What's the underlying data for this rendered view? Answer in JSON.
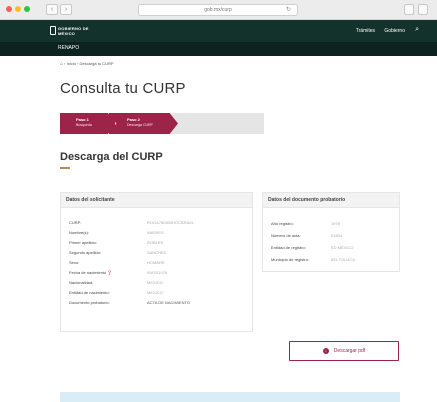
{
  "browser": {
    "url": "gob.mx/curp",
    "back": "‹",
    "forward": "›",
    "reload": "↻"
  },
  "header": {
    "logo_line1": "GOBIERNO DE",
    "logo_line2": "MÉXICO",
    "links": [
      "Trámites",
      "Gobierno"
    ],
    "search_icon": "search-icon"
  },
  "subheader": {
    "title": "RENAPO"
  },
  "breadcrumb": {
    "home_icon": "home-icon",
    "text": "› Inicio › Descarga tu CURP"
  },
  "page_title": "Consulta tu CURP",
  "stepper": {
    "steps": [
      {
        "title": "Paso 1",
        "subtitle": "Búsqueda"
      },
      {
        "title": "Paso 2",
        "subtitle": "Descarga CURP"
      }
    ]
  },
  "section_title": "Descarga del CURP",
  "solicitante": {
    "heading": "Datos del solicitante",
    "rows": [
      {
        "label": "CURP:",
        "value": "ROGA780309HOCBRA01"
      },
      {
        "label": "Nombre(s):",
        "value": "ANDRES"
      },
      {
        "label": "Primer apellido:",
        "value": "ROBLES"
      },
      {
        "label": "Segundo apellido:",
        "value": "SANCHEZ"
      },
      {
        "label": "Sexo:",
        "value": "HOMBRE"
      },
      {
        "label": "Fecha de nacimiento",
        "value": "09/03/1978"
      },
      {
        "label": "Nacionalidad:",
        "value": "MEXICO"
      },
      {
        "label": "Entidad de nacimiento:",
        "value": "MEXICO"
      },
      {
        "label": "Documento probatorio:",
        "value": "ACTA DE NACIMIENTO"
      }
    ]
  },
  "probatorio": {
    "heading": "Datos del documento probatorio",
    "rows": [
      {
        "label": "Año registro:",
        "value": "1978"
      },
      {
        "label": "Número de acta:",
        "value": "01804"
      },
      {
        "label": "Entidad de registro:",
        "value": "ED MÉXICO"
      },
      {
        "label": "Municipio de registro:",
        "value": "051 TOLUCA"
      }
    ]
  },
  "download": {
    "label": "Descargar pdf",
    "icon": "download-icon"
  },
  "colors": {
    "header_bg": "#13322b",
    "accent": "#9d2449",
    "gold": "#b38e5d"
  }
}
